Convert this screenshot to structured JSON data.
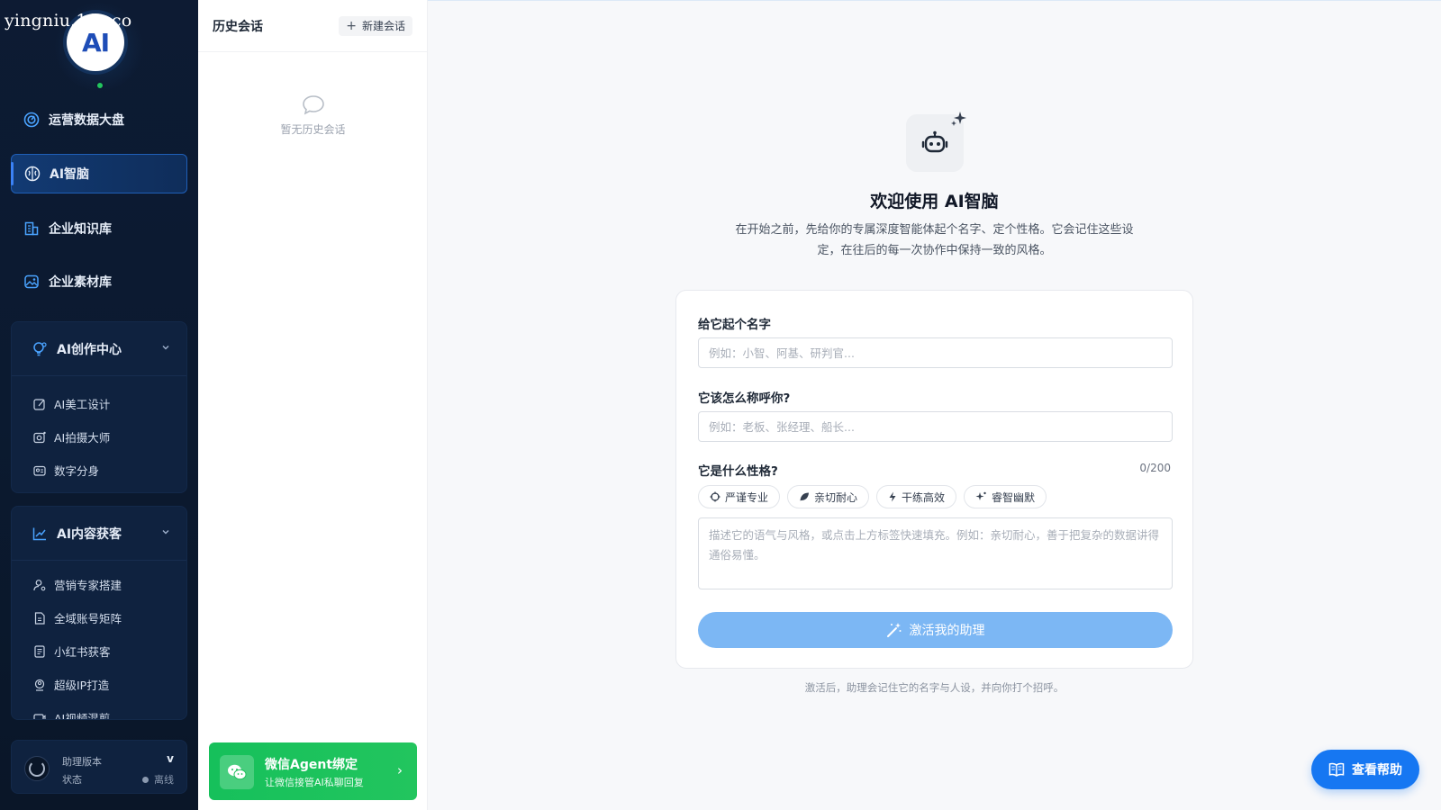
{
  "watermark": "yingniu.10v.co",
  "logo": {
    "text": "AI"
  },
  "sidebar": {
    "items": [
      {
        "label": "运营数据大盘",
        "icon": "dashboard-icon"
      },
      {
        "label": "AI智脑",
        "icon": "brain-icon",
        "active": true
      },
      {
        "label": "企业知识库",
        "icon": "building-icon"
      },
      {
        "label": "企业素材库",
        "icon": "image-icon"
      }
    ],
    "groups": [
      {
        "label": "AI创作中心",
        "icon": "lightbulb-icon",
        "items": [
          {
            "label": "AI美工设计",
            "icon": "design-icon"
          },
          {
            "label": "AI拍摄大师",
            "icon": "camera-icon"
          },
          {
            "label": "数字分身",
            "icon": "id-card-icon"
          }
        ]
      },
      {
        "label": "AI内容获客",
        "icon": "trend-chart-icon",
        "items": [
          {
            "label": "营销专家搭建",
            "icon": "user-gear-icon"
          },
          {
            "label": "全域账号矩阵",
            "icon": "file-icon"
          },
          {
            "label": "小红书获客",
            "icon": "book-icon"
          },
          {
            "label": "超级IP打造",
            "icon": "badge-icon"
          },
          {
            "label": "AI视频混剪",
            "icon": "video-icon"
          }
        ]
      }
    ],
    "version": {
      "label": "助理版本",
      "value": "v",
      "status_label": "状态",
      "status_value": "离线"
    }
  },
  "history": {
    "title": "历史会话",
    "new_button": "新建会话",
    "empty_text": "暂无历史会话",
    "wechat": {
      "title": "微信Agent绑定",
      "subtitle": "让微信接管AI私聊回复",
      "arrow": "›"
    }
  },
  "main": {
    "title": "欢迎使用 AI智脑",
    "description": "在开始之前，先给你的专属深度智能体起个名字、定个性格。它会记住这些设定，在往后的每一次协作中保持一致的风格。",
    "form": {
      "name_label": "给它起个名字",
      "name_placeholder": "例如：小智、阿基、研判官...",
      "call_label": "它该怎么称呼你?",
      "call_placeholder": "例如：老板、张经理、船长...",
      "personality_label": "它是什么性格?",
      "counter": "0/200",
      "tags": [
        {
          "label": "严谨专业",
          "icon": "target-icon"
        },
        {
          "label": "亲切耐心",
          "icon": "leaf-icon"
        },
        {
          "label": "干练高效",
          "icon": "lightning-icon"
        },
        {
          "label": "睿智幽默",
          "icon": "sparkle-icon"
        }
      ],
      "personality_placeholder": "描述它的语气与风格，或点击上方标签快速填充。例如：亲切耐心，善于把复杂的数据讲得通俗易懂。",
      "activate_button": "激活我的助理"
    },
    "footer_note": "激活后，助理会记住它的名字与人设，并向你打个招呼。"
  },
  "help_button": "查看帮助",
  "colors": {
    "sidebar_bg": "#0d1b33",
    "primary": "#1677f2",
    "activate_disabled": "#7cb7f4",
    "wechat_green": "#16c05b",
    "online": "#22c55e"
  }
}
